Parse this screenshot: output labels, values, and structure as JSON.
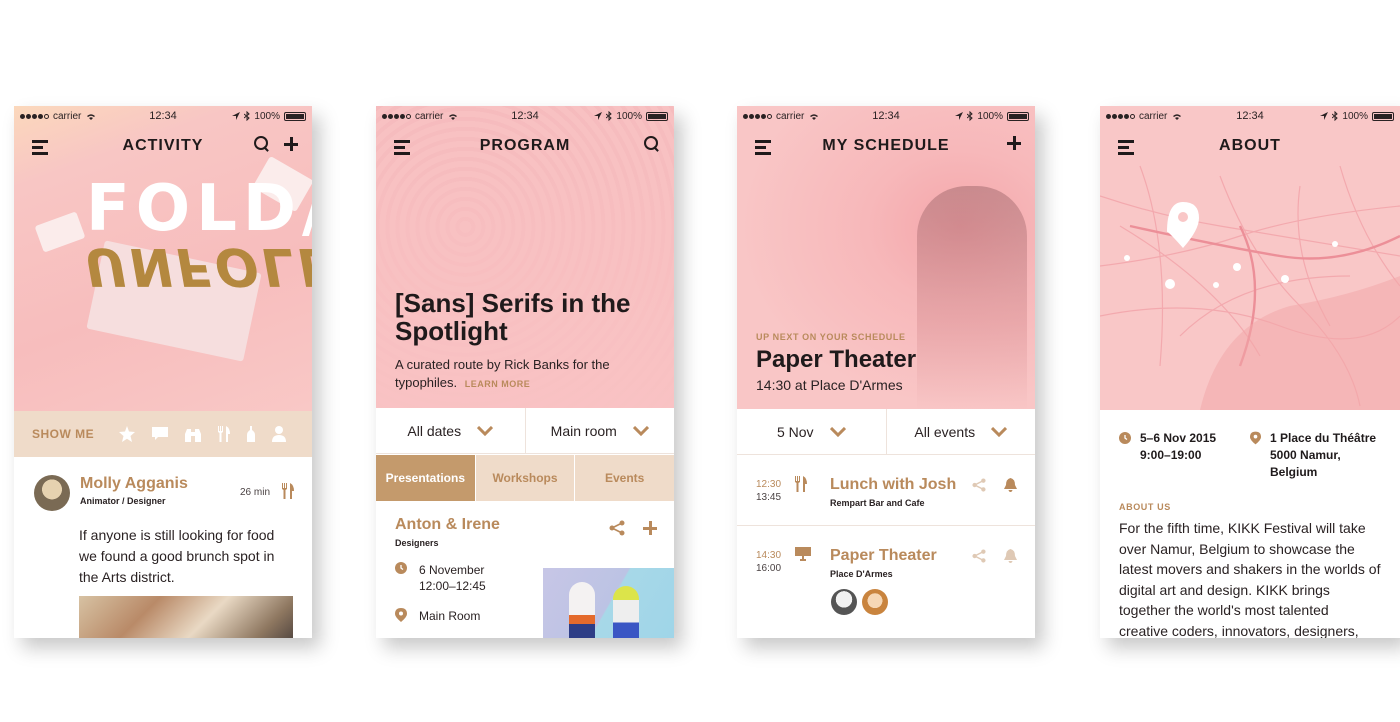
{
  "colors": {
    "accent": "#b98a5c",
    "hero_pink": "#f8c0c0",
    "tab_beige": "#efdbc9",
    "tab_active": "#c49a6c"
  },
  "status_bar": {
    "carrier": "carrier",
    "time": "12:34",
    "battery": "100%"
  },
  "screens": {
    "activity": {
      "title": "ACTIVITY",
      "hero_art_top": "FOLD/",
      "hero_art_bottom": "UNFOLD",
      "show_me": {
        "label": "SHOW ME",
        "icons": [
          "star-icon",
          "chat-icon",
          "binoculars-icon",
          "fork-knife-icon",
          "bottle-icon",
          "person-icon"
        ]
      },
      "post": {
        "author": "Molly Agganis",
        "role": "Animator / Designer",
        "time": "26 min",
        "text": "If anyone is still looking for food we found a good brunch spot in the Arts district."
      }
    },
    "program": {
      "title": "PROGRAM",
      "hero_title": "[Sans] Serifs in the Spotlight",
      "hero_sub": "A curated route by Rick Banks for the typophiles.",
      "learn_more": "LEARN MORE",
      "filters": [
        "All dates",
        "Main room"
      ],
      "tabs": [
        "Presentations",
        "Workshops",
        "Events"
      ],
      "event": {
        "name": "Anton & Irene",
        "subtitle": "Designers",
        "date": "6 November",
        "time": "12:00–12:45",
        "room": "Main Room"
      }
    },
    "schedule": {
      "title": "MY SCHEDULE",
      "up_next_label": "UP NEXT ON YOUR SCHEDULE",
      "hero_title": "Paper Theater",
      "hero_sub": "14:30 at Place D'Armes",
      "filters": [
        "5 Nov",
        "All events"
      ],
      "items": [
        {
          "start": "12:30",
          "end": "13:45",
          "title": "Lunch with Josh",
          "place": "Rempart Bar and Cafe"
        },
        {
          "start": "14:30",
          "end": "16:00",
          "title": "Paper Theater",
          "place": "Place D'Armes"
        }
      ]
    },
    "about": {
      "title": "ABOUT",
      "dates": "5–6 Nov 2015",
      "hours": "9:00–19:00",
      "address_line1": "1 Place du Théâtre",
      "address_line2": "5000 Namur,",
      "address_line3": "Belgium",
      "about_label": "ABOUT US",
      "about_text": "For the fifth time, KIKK Festival will take over Namur, Belgium to showcase the latest movers and shakers in the worlds of digital art and design. KIKK brings together the world's most talented creative coders, innovators, designers, artists and"
    }
  }
}
